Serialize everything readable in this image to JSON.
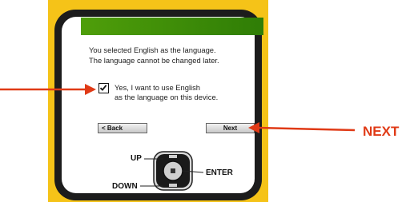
{
  "screen": {
    "message_line1": "You selected English as the language.",
    "message_line2": "The language cannot be changed later.",
    "checkbox": {
      "checked": true,
      "label_line1": "Yes, I want to use English",
      "label_line2": "as the language on this device."
    },
    "back_button": "< Back",
    "next_button": "Next"
  },
  "keypad": {
    "up_label": "UP",
    "down_label": "DOWN",
    "enter_label": "ENTER"
  },
  "annotations": {
    "next_callout": "NEXT",
    "arrow_color": "#e03a16"
  },
  "colors": {
    "frame": "#f5c318",
    "bezel": "#1c1c1c",
    "header_bar": "#3f8f08"
  }
}
